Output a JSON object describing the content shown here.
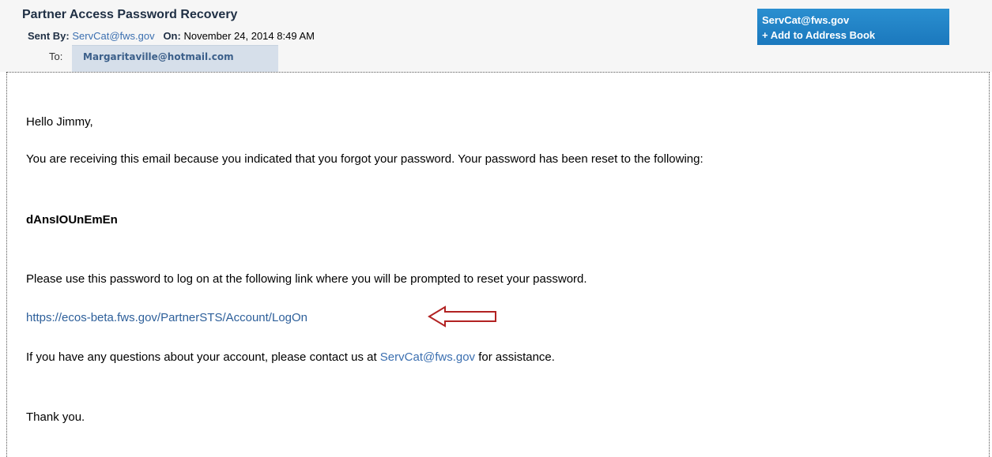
{
  "email": {
    "subject": "Partner Access Password Recovery",
    "sent_by_label": "Sent By:",
    "sender": "ServCat@fws.gov",
    "on_label": "On:",
    "date": "November 24, 2014 8:49 AM",
    "to_label": "To:",
    "recipient": "Margaritaville@hotmail.com",
    "sender_box": {
      "address": "ServCat@fws.gov",
      "add_to_book": "+ Add to Address Book"
    }
  },
  "body": {
    "greeting": "Hello Jimmy,",
    "para1": "You are receiving this email because you indicated that you forgot your password. Your password has been reset to the following:",
    "password": "dAnsIOUnEmEn",
    "para2": "Please use this password to log on at the following link where you will be prompted to reset your password.",
    "logon_link": "https://ecos-beta.fws.gov/PartnerSTS/Account/LogOn",
    "para3_before": "If you have any questions about your account, please contact us at ",
    "contact_email": "ServCat@fws.gov",
    "para3_after": " for assistance.",
    "closing": "Thank you."
  },
  "colors": {
    "link": "#3b6fb0",
    "annotation_arrow": "#b22222",
    "sender_box": "#2a8fd0"
  },
  "icons": [
    "left-arrow-annotation-icon"
  ]
}
